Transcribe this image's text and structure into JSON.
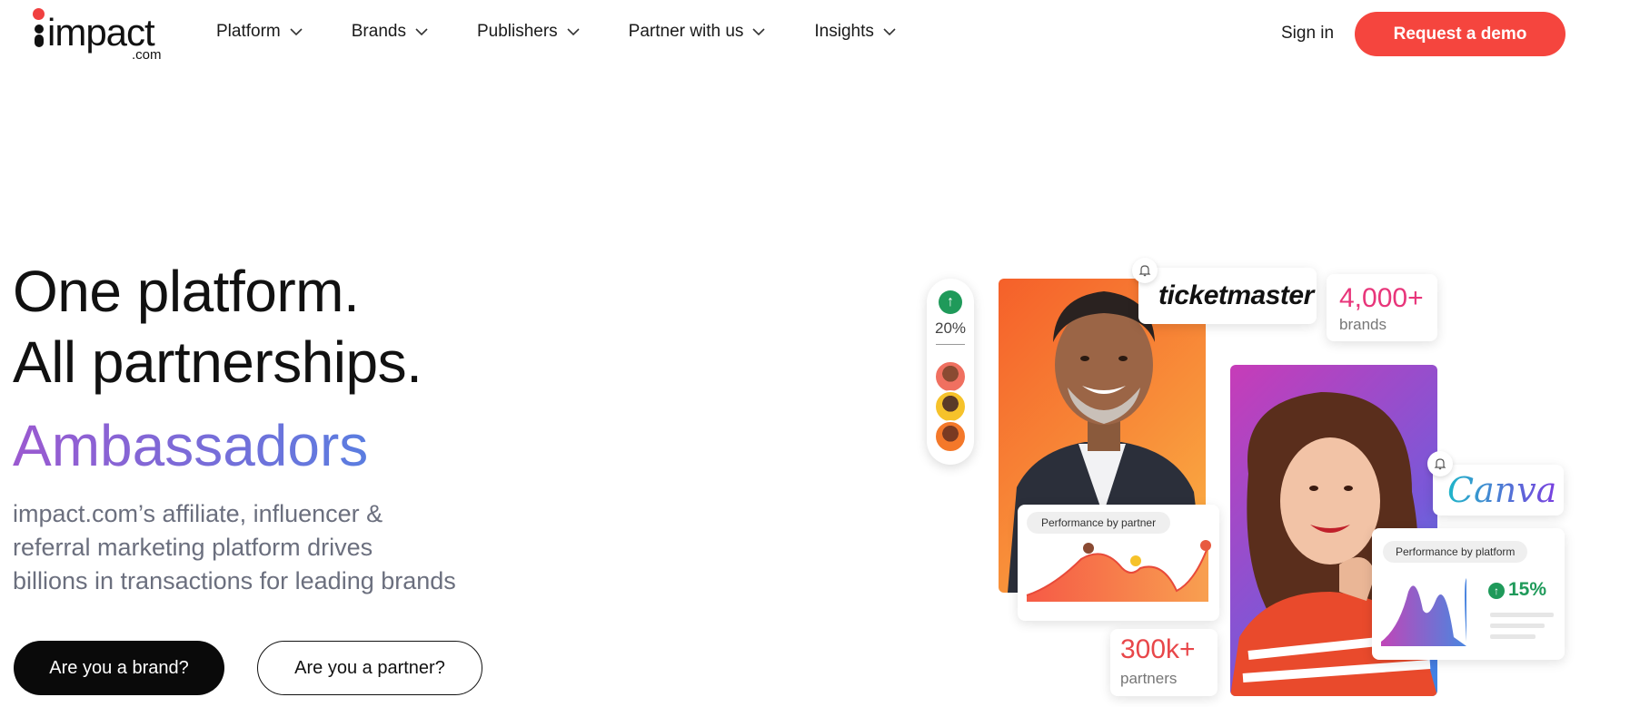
{
  "nav": {
    "logo_word": "impact",
    "logo_com": ".com",
    "items": [
      {
        "label": "Platform"
      },
      {
        "label": "Brands"
      },
      {
        "label": "Publishers"
      },
      {
        "label": "Partner with us"
      },
      {
        "label": "Insights"
      }
    ],
    "signin": "Sign in",
    "demo": "Request a demo"
  },
  "hero": {
    "line1": "One platform.",
    "line2": "All partnerships.",
    "rotating": "Ambassadors",
    "desc_line1": "impact.com’s affiliate, influencer &",
    "desc_line2": "referral marketing platform drives",
    "desc_line3": "billions in transactions for leading brands",
    "btn_brand": "Are you a brand?",
    "btn_partner": "Are you a partner?"
  },
  "graphic": {
    "growth_pct": "20%",
    "ticketmaster": "ticketmaster",
    "brands_count": "4,000+",
    "brands_label": "brands",
    "canva": "Canva",
    "perf_partner": "Performance by partner",
    "perf_platform": "Performance by platform",
    "platform_pct": "15%",
    "partners_count": "300k+",
    "partners_label": "partners"
  },
  "colors": {
    "accent": "#f5453e",
    "brand_gradient_start": "#9b59d0",
    "brand_gradient_end": "#5a7de0",
    "growth_green": "#1f9a5a",
    "stat_pink": "#e8357a"
  }
}
